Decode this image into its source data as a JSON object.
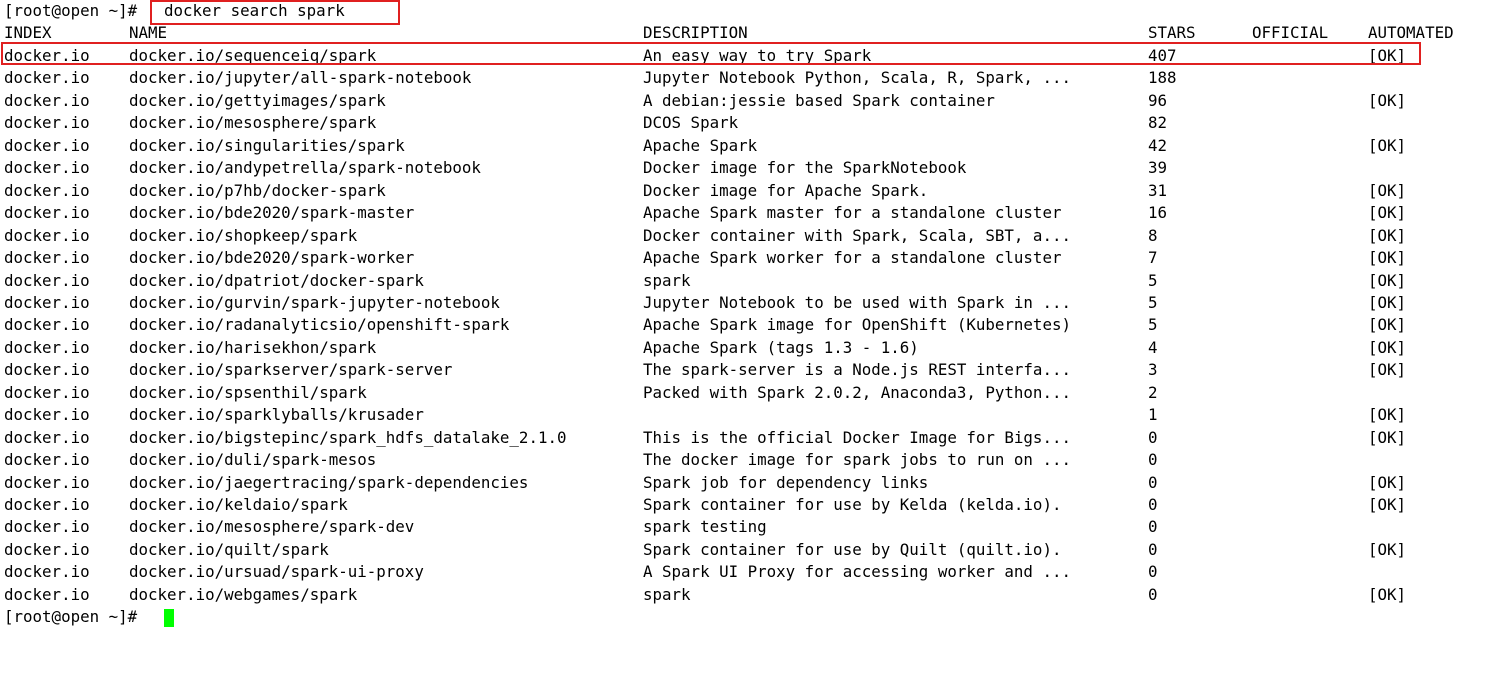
{
  "terminal": {
    "prompt": "[root@open ~]#",
    "command": "docker search spark",
    "headers": {
      "index": "INDEX",
      "name": "NAME",
      "description": "DESCRIPTION",
      "stars": "STARS",
      "official": "OFFICIAL",
      "automated": "AUTOMATED"
    },
    "rows": [
      {
        "index": "docker.io",
        "name": "docker.io/sequenceiq/spark",
        "description": "An easy way to try Spark",
        "stars": "407",
        "official": "",
        "automated": "[OK]"
      },
      {
        "index": "docker.io",
        "name": "docker.io/jupyter/all-spark-notebook",
        "description": "Jupyter Notebook Python, Scala, R, Spark, ...",
        "stars": "188",
        "official": "",
        "automated": ""
      },
      {
        "index": "docker.io",
        "name": "docker.io/gettyimages/spark",
        "description": "A debian:jessie based Spark container",
        "stars": "96",
        "official": "",
        "automated": "[OK]"
      },
      {
        "index": "docker.io",
        "name": "docker.io/mesosphere/spark",
        "description": "DCOS Spark",
        "stars": "82",
        "official": "",
        "automated": ""
      },
      {
        "index": "docker.io",
        "name": "docker.io/singularities/spark",
        "description": "Apache Spark",
        "stars": "42",
        "official": "",
        "automated": "[OK]"
      },
      {
        "index": "docker.io",
        "name": "docker.io/andypetrella/spark-notebook",
        "description": "Docker image for the SparkNotebook",
        "stars": "39",
        "official": "",
        "automated": ""
      },
      {
        "index": "docker.io",
        "name": "docker.io/p7hb/docker-spark",
        "description": "Docker image for Apache Spark.",
        "stars": "31",
        "official": "",
        "automated": "[OK]"
      },
      {
        "index": "docker.io",
        "name": "docker.io/bde2020/spark-master",
        "description": "Apache Spark master for a standalone cluster",
        "stars": "16",
        "official": "",
        "automated": "[OK]"
      },
      {
        "index": "docker.io",
        "name": "docker.io/shopkeep/spark",
        "description": "Docker container with Spark, Scala, SBT, a...",
        "stars": "8",
        "official": "",
        "automated": "[OK]"
      },
      {
        "index": "docker.io",
        "name": "docker.io/bde2020/spark-worker",
        "description": "Apache Spark worker for a standalone cluster",
        "stars": "7",
        "official": "",
        "automated": "[OK]"
      },
      {
        "index": "docker.io",
        "name": "docker.io/dpatriot/docker-spark",
        "description": "spark",
        "stars": "5",
        "official": "",
        "automated": "[OK]"
      },
      {
        "index": "docker.io",
        "name": "docker.io/gurvin/spark-jupyter-notebook",
        "description": "Jupyter Notebook to be used with Spark in ...",
        "stars": "5",
        "official": "",
        "automated": "[OK]"
      },
      {
        "index": "docker.io",
        "name": "docker.io/radanalyticsio/openshift-spark",
        "description": "Apache Spark image for OpenShift (Kubernetes)",
        "stars": "5",
        "official": "",
        "automated": "[OK]"
      },
      {
        "index": "docker.io",
        "name": "docker.io/harisekhon/spark",
        "description": "Apache Spark (tags 1.3 - 1.6)",
        "stars": "4",
        "official": "",
        "automated": "[OK]"
      },
      {
        "index": "docker.io",
        "name": "docker.io/sparkserver/spark-server",
        "description": "The spark-server is a Node.js REST interfa...",
        "stars": "3",
        "official": "",
        "automated": "[OK]"
      },
      {
        "index": "docker.io",
        "name": "docker.io/spsenthil/spark",
        "description": "Packed with Spark 2.0.2, Anaconda3, Python...",
        "stars": "2",
        "official": "",
        "automated": ""
      },
      {
        "index": "docker.io",
        "name": "docker.io/sparklyballs/krusader",
        "description": "",
        "stars": "1",
        "official": "",
        "automated": "[OK]"
      },
      {
        "index": "docker.io",
        "name": "docker.io/bigstepinc/spark_hdfs_datalake_2.1.0",
        "description": "This is the official Docker Image for Bigs...",
        "stars": "0",
        "official": "",
        "automated": "[OK]"
      },
      {
        "index": "docker.io",
        "name": "docker.io/duli/spark-mesos",
        "description": "The docker image for spark jobs to run on ...",
        "stars": "0",
        "official": "",
        "automated": ""
      },
      {
        "index": "docker.io",
        "name": "docker.io/jaegertracing/spark-dependencies",
        "description": "Spark job for dependency links",
        "stars": "0",
        "official": "",
        "automated": "[OK]"
      },
      {
        "index": "docker.io",
        "name": "docker.io/keldaio/spark",
        "description": "Spark container for use by Kelda (kelda.io).",
        "stars": "0",
        "official": "",
        "automated": "[OK]"
      },
      {
        "index": "docker.io",
        "name": "docker.io/mesosphere/spark-dev",
        "description": "spark testing",
        "stars": "0",
        "official": "",
        "automated": ""
      },
      {
        "index": "docker.io",
        "name": "docker.io/quilt/spark",
        "description": "Spark container for use by Quilt (quilt.io).",
        "stars": "0",
        "official": "",
        "automated": "[OK]"
      },
      {
        "index": "docker.io",
        "name": "docker.io/ursuad/spark-ui-proxy",
        "description": "A Spark UI Proxy for accessing worker and ...",
        "stars": "0",
        "official": "",
        "automated": ""
      },
      {
        "index": "docker.io",
        "name": "docker.io/webgames/spark",
        "description": "spark",
        "stars": "0",
        "official": "",
        "automated": "[OK]"
      }
    ]
  },
  "colors": {
    "background": "#ffffff",
    "text": "#000000",
    "highlight": "#e02020",
    "cursor": "#00ff00"
  }
}
